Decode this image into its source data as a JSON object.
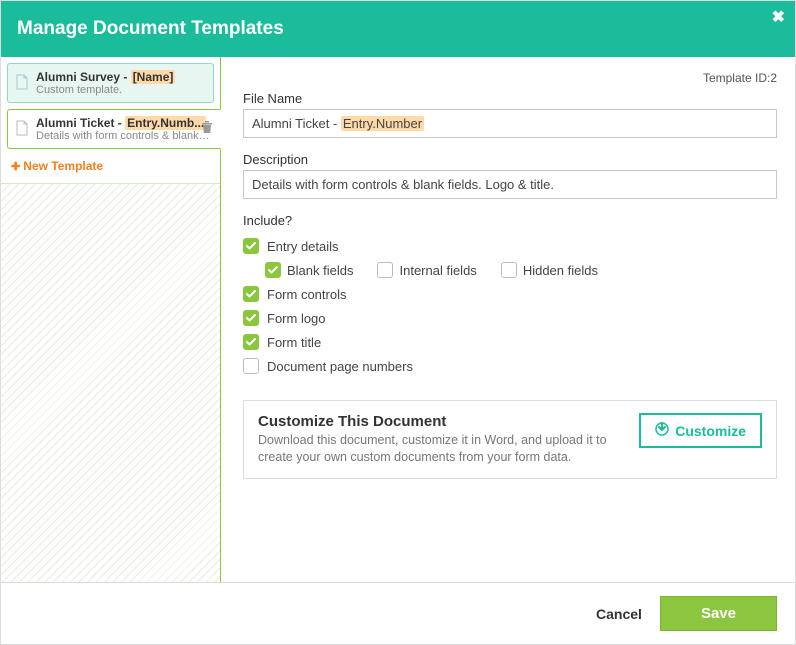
{
  "header": {
    "title": "Manage Document Templates"
  },
  "template_id_label": "Template ID:2",
  "sidebar": {
    "items": [
      {
        "title_pre": "Alumni Survey -  ",
        "title_tag": "[Name]",
        "title_post": "",
        "sub": "Custom template."
      },
      {
        "title_pre": "Alumni Ticket -  ",
        "title_tag": "Entry.Numb...",
        "title_post": "",
        "sub": "Details with form controls & blank fie..."
      }
    ],
    "new_label": "New Template"
  },
  "form": {
    "file_name_label": "File Name",
    "file_name_pre": "Alumni Ticket -  ",
    "file_name_tag": "Entry.Number",
    "description_label": "Description",
    "description_value": "Details with form controls & blank fields. Logo & title.",
    "include_label": "Include?",
    "options": {
      "entry_details": "Entry details",
      "blank_fields": "Blank fields",
      "internal_fields": "Internal fields",
      "hidden_fields": "Hidden fields",
      "form_controls": "Form controls",
      "form_logo": "Form logo",
      "form_title": "Form title",
      "doc_page_numbers": "Document page numbers"
    },
    "checks": {
      "entry_details": true,
      "blank_fields": true,
      "internal_fields": false,
      "hidden_fields": false,
      "form_controls": true,
      "form_logo": true,
      "form_title": true,
      "doc_page_numbers": false
    }
  },
  "customize": {
    "title": "Customize This Document",
    "desc": "Download this document, customize it in Word, and upload it to create your own custom documents from your form data.",
    "button": "Customize"
  },
  "footer": {
    "cancel": "Cancel",
    "save": "Save"
  }
}
